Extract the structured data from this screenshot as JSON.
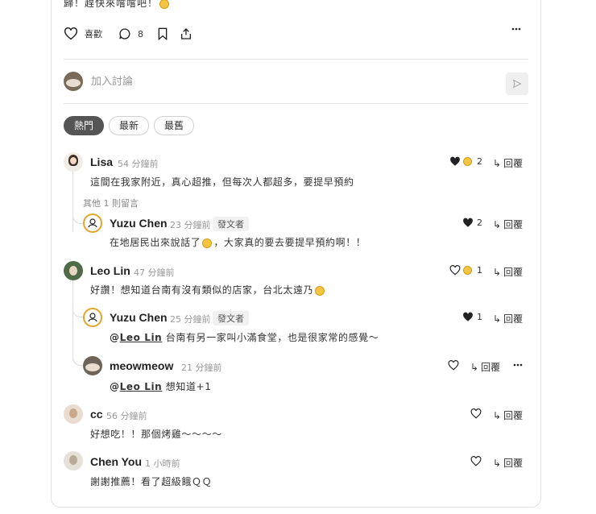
{
  "post": {
    "tail_text": "歸！趕快來嚐嚐吧！",
    "like_label": "喜歡",
    "comment_count": "8"
  },
  "composer": {
    "placeholder": "加入討論"
  },
  "tabs": [
    {
      "label": "熱門",
      "active": true
    },
    {
      "label": "最新",
      "active": false
    },
    {
      "label": "最舊",
      "active": false
    }
  ],
  "reply_label": "回覆",
  "author_badge": "發文者",
  "comments": [
    {
      "name": "Lisa",
      "time": "54 分鐘前",
      "text": "這間在我家附近，真心超推，但每次人都超多，要提早預約",
      "likes": "2",
      "more_replies": "其他 1 則留言"
    },
    {
      "name": "Yuzu Chen",
      "time": "23 分鐘前",
      "text_a": "在地居民出來說話了",
      "text_b": "，大家真的要去要提早預約啊！！",
      "likes": "2"
    },
    {
      "name": "Leo Lin",
      "time": "47 分鐘前",
      "text": "好讚！想知道台南有沒有類似的店家，台北太遠乃",
      "likes": "1"
    },
    {
      "name": "Yuzu Chen",
      "time": "25 分鐘前",
      "mention": "Leo Lin",
      "text": " 台南有另一家叫小滿食堂，也是很家常的感覺～",
      "likes": "1"
    },
    {
      "name": "meowmeow",
      "time": "21 分鐘前",
      "mention": "Leo Lin",
      "text": " 想知道+1"
    },
    {
      "name": "cc",
      "time": "56 分鐘前",
      "text": "好想吃！！那個烤雞～～～～"
    },
    {
      "name": "Chen You",
      "time": "1 小時前",
      "text": "謝謝推薦！看了超級餓ＱＱ"
    }
  ]
}
